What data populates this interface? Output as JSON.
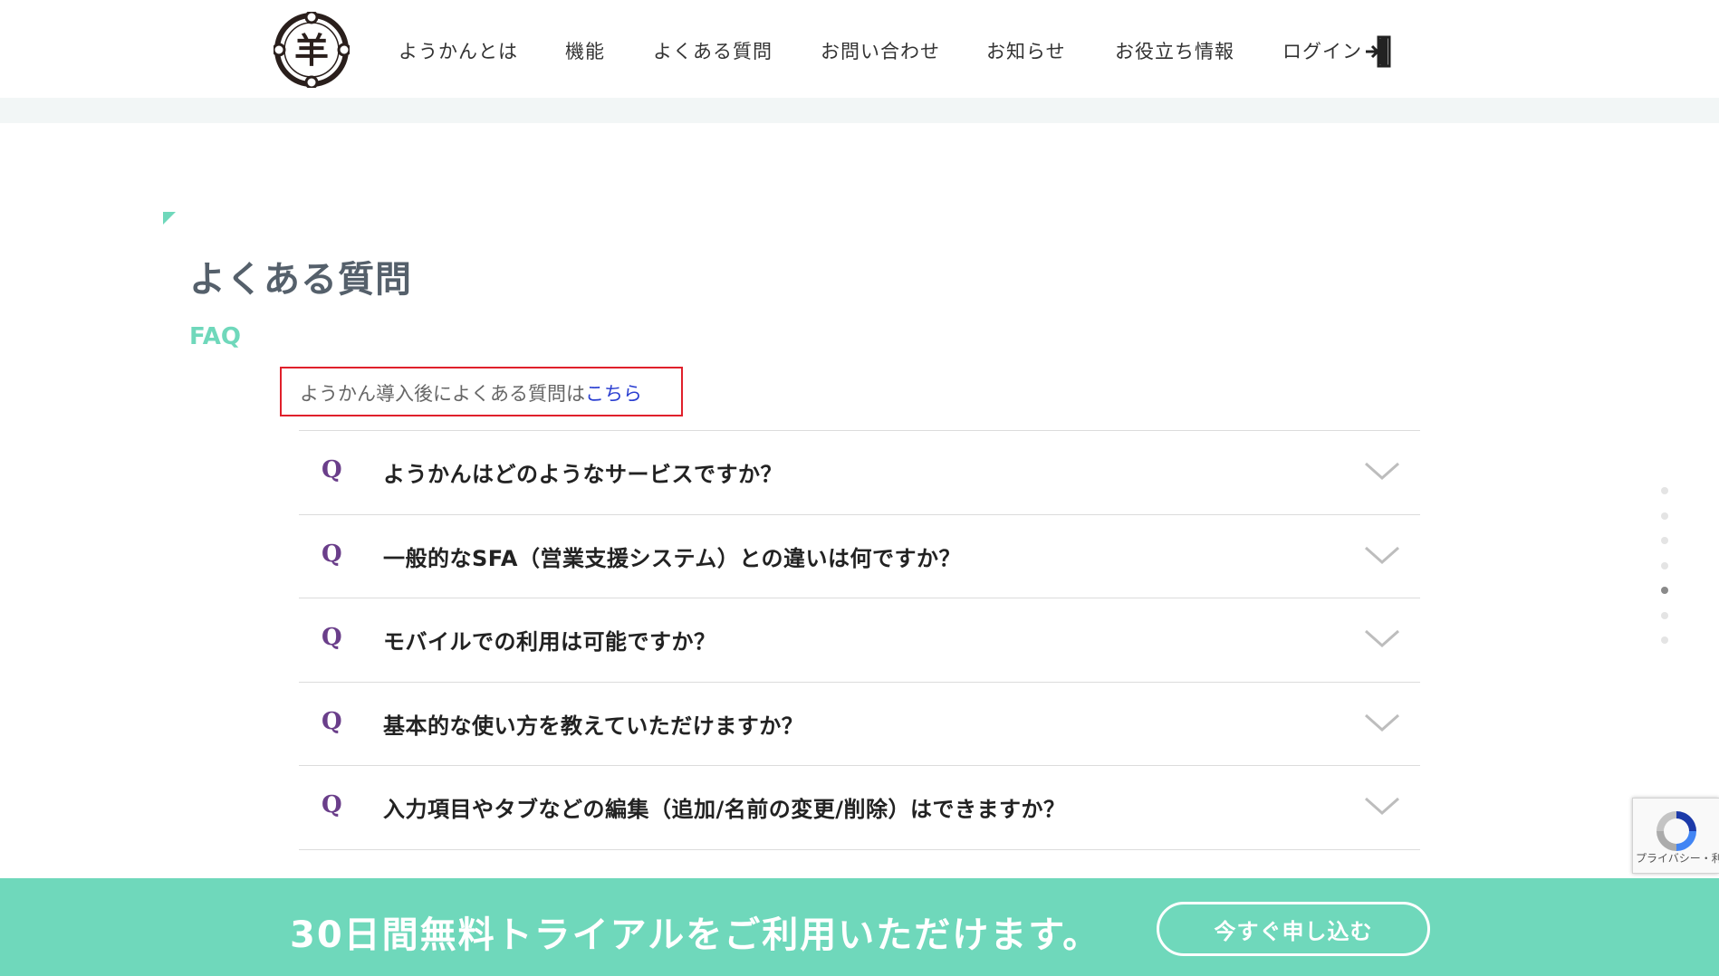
{
  "header": {
    "logo_glyph": "羊",
    "nav": [
      {
        "label": "ようかんとは"
      },
      {
        "label": "機能"
      },
      {
        "label": "よくある質問"
      },
      {
        "label": "お問い合わせ"
      },
      {
        "label": "お知らせ"
      },
      {
        "label": "お役立ち情報"
      },
      {
        "label": "ログイン"
      }
    ]
  },
  "main": {
    "title": "よくある質問",
    "subtitle": "FAQ",
    "notice": {
      "text": "ようかん導入後によくある質問は",
      "link": "こちら"
    },
    "faq": [
      {
        "marker": "Q",
        "question": "ようかんはどのようなサービスですか？"
      },
      {
        "marker": "Q",
        "question": "一般的なSFA（営業支援システム）との違いは何ですか？"
      },
      {
        "marker": "Q",
        "question": "モバイルでの利用は可能ですか？"
      },
      {
        "marker": "Q",
        "question": "基本的な使い方を教えていただけますか？"
      },
      {
        "marker": "Q",
        "question": "入力項目やタブなどの編集（追加/名前の変更/削除）はできますか？"
      }
    ]
  },
  "page_indicator": {
    "count": 7,
    "active_index": 4
  },
  "recaptcha": {
    "text": "プライバシー・利用規約"
  },
  "cta": {
    "text": "30日間無料トライアルをご利用いただけます。",
    "button": "今すぐ申し込む"
  },
  "colors": {
    "accent": "#6fd8bb",
    "title": "#55606b",
    "q_marker": "#6a3e8a",
    "notice_border": "#e0202b",
    "link": "#2b3fd1"
  }
}
